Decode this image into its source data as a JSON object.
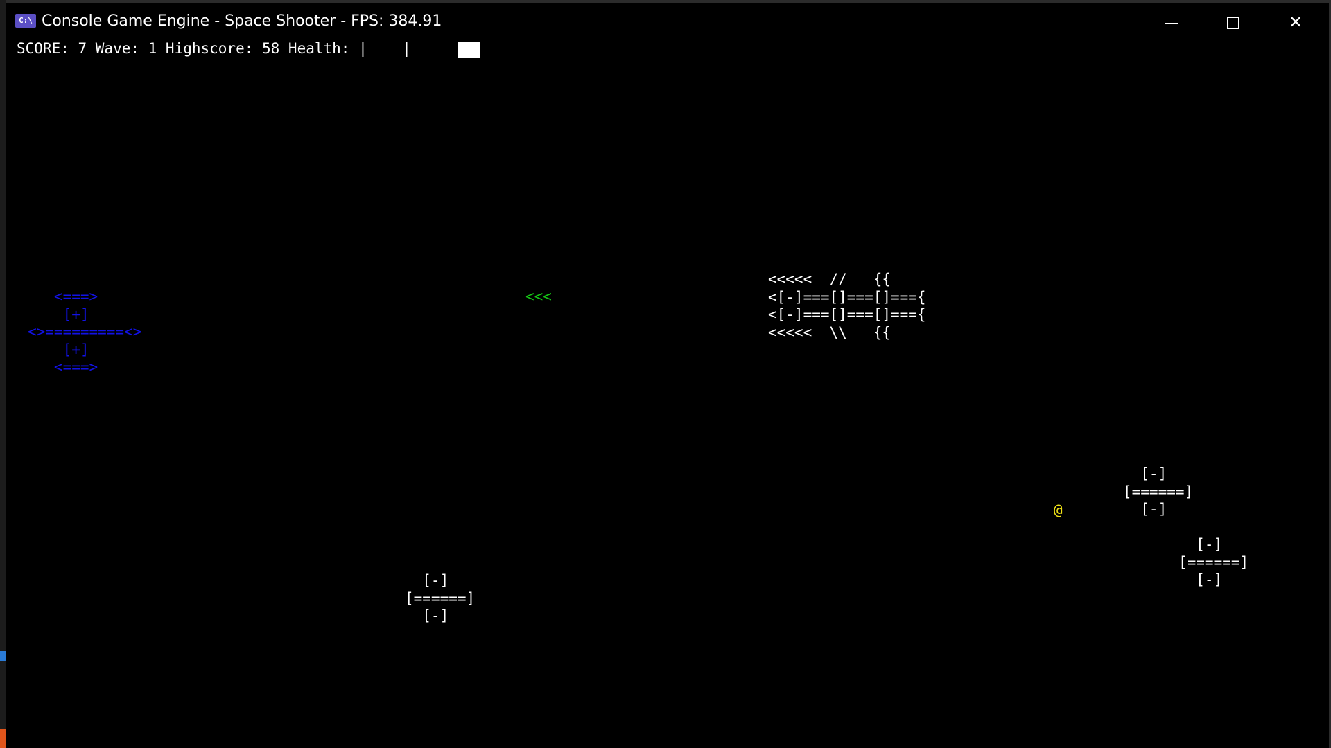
{
  "window": {
    "title": "Console Game Engine - Space Shooter - FPS: 384.91",
    "icon": "C:\\",
    "controls": {
      "minimize": "minimize-icon",
      "maximize": "maximize-icon",
      "close": "✕"
    }
  },
  "colors": {
    "background": "#000000",
    "text": "#ffffff",
    "player": "#1212e6",
    "player_shot": "#16c616",
    "pickup": "#f0e216",
    "icon_bg": "#5b4fc4",
    "left_accent": "#2a7bd6",
    "left_accent_2": "#e0551b"
  },
  "hud": {
    "text": "SCORE: 7 Wave: 1 Highscore: 58 Health: |    |",
    "score": 7,
    "wave": 1,
    "highscore": 58,
    "health_level": 0.25
  },
  "sprites": {
    "player_ship": "   <===>\n    [+]\n<>=========<>\n    [+]\n   <===>",
    "player_shot": "<<<",
    "boss": "<<<<<  //   {{\n<[-]===[]===[]==={\n<[-]===[]===[]==={\n<<<<<  \\\\   {{",
    "enemy_1": "  [-]\n[======]\n  [-]",
    "enemy_2": "  [-]\n[======]\n  [-]",
    "enemy_3": "  [-]\n[======]\n  [-]",
    "pickup": "@"
  }
}
